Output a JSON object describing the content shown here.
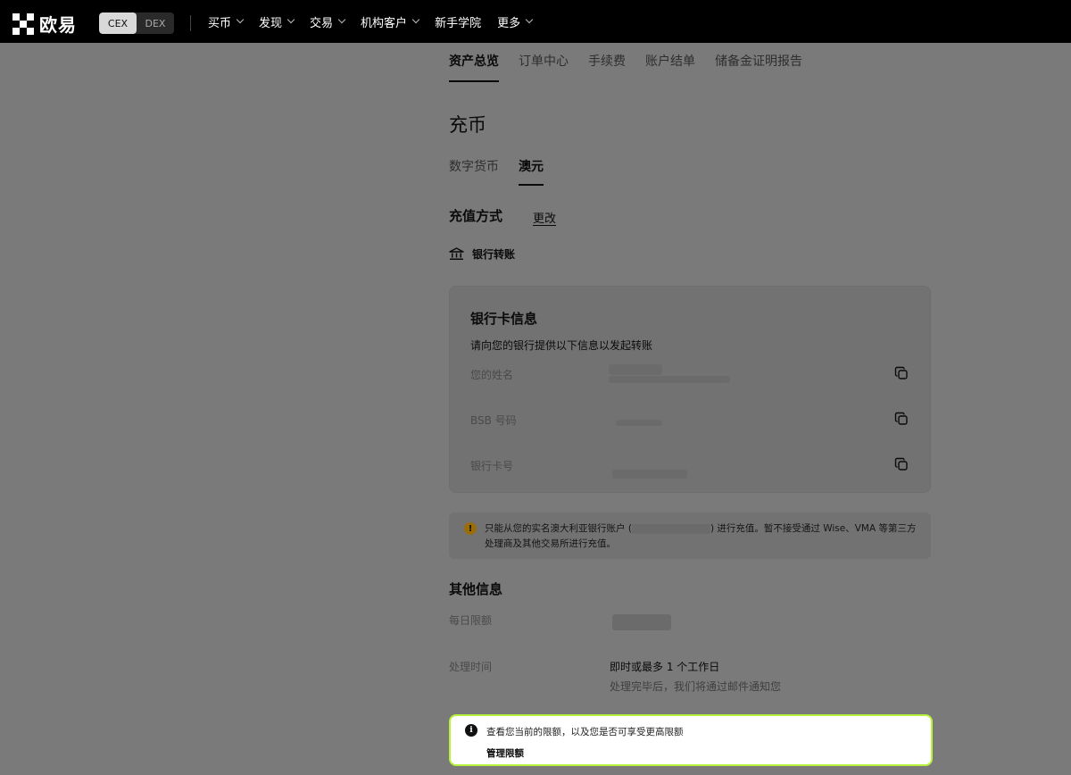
{
  "brand": {
    "name": "欧易"
  },
  "mode_switch": {
    "cex": "CEX",
    "dex": "DEX"
  },
  "nav": [
    {
      "label": "买币",
      "dropdown": true
    },
    {
      "label": "发现",
      "dropdown": true
    },
    {
      "label": "交易",
      "dropdown": true
    },
    {
      "label": "机构客户",
      "dropdown": true
    },
    {
      "label": "新手学院",
      "dropdown": false
    },
    {
      "label": "更多",
      "dropdown": true
    }
  ],
  "tabs": [
    "资产总览",
    "订单中心",
    "手续费",
    "账户结单",
    "储备金证明报告"
  ],
  "active_tab": "资产总览",
  "page_title": "充币",
  "subtabs": [
    "数字货币",
    "澳元"
  ],
  "active_subtab": "澳元",
  "method": {
    "label": "充值方式",
    "change": "更改",
    "selected": "银行转账",
    "icon": "bank-icon"
  },
  "bank_card": {
    "title": "银行卡信息",
    "subtitle": "请向您的银行提供以下信息以发起转账",
    "rows": [
      {
        "label": "您的姓名",
        "icon": "copy-icon"
      },
      {
        "label": "BSB 号码",
        "icon": "copy-icon"
      },
      {
        "label": "银行卡号",
        "icon": "copy-icon"
      }
    ]
  },
  "warning": {
    "icon": "warning-icon",
    "text_before": "只能从您的实名澳大利亚银行账户 (",
    "text_after": ") 进行充值。暂不接受通过 Wise、VMA 等第三方处理商及其他交易所进行充值。"
  },
  "other_info": {
    "title": "其他信息",
    "daily_limit_label": "每日限额",
    "processing_label": "处理时间",
    "processing_value": "即时或最多 1 个工作日",
    "processing_note": "处理完毕后，我们将通过邮件通知您"
  },
  "limit_notice": {
    "icon": "info-icon",
    "text": "查看您当前的限额，以及您是否可享受更高限额",
    "link": "管理限额"
  },
  "colors": {
    "highlight_border": "#b6f23a",
    "warning": "#9a6d0a",
    "topbar": "#000000"
  }
}
